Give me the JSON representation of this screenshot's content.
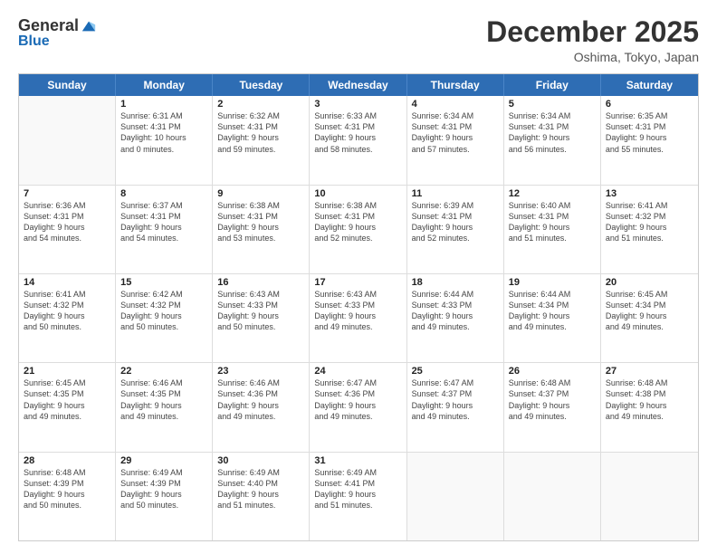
{
  "logo": {
    "general": "General",
    "blue": "Blue"
  },
  "title": "December 2025",
  "location": "Oshima, Tokyo, Japan",
  "header_days": [
    "Sunday",
    "Monday",
    "Tuesday",
    "Wednesday",
    "Thursday",
    "Friday",
    "Saturday"
  ],
  "weeks": [
    [
      {
        "day": "",
        "lines": [],
        "empty": true
      },
      {
        "day": "1",
        "lines": [
          "Sunrise: 6:31 AM",
          "Sunset: 4:31 PM",
          "Daylight: 10 hours",
          "and 0 minutes."
        ]
      },
      {
        "day": "2",
        "lines": [
          "Sunrise: 6:32 AM",
          "Sunset: 4:31 PM",
          "Daylight: 9 hours",
          "and 59 minutes."
        ]
      },
      {
        "day": "3",
        "lines": [
          "Sunrise: 6:33 AM",
          "Sunset: 4:31 PM",
          "Daylight: 9 hours",
          "and 58 minutes."
        ]
      },
      {
        "day": "4",
        "lines": [
          "Sunrise: 6:34 AM",
          "Sunset: 4:31 PM",
          "Daylight: 9 hours",
          "and 57 minutes."
        ]
      },
      {
        "day": "5",
        "lines": [
          "Sunrise: 6:34 AM",
          "Sunset: 4:31 PM",
          "Daylight: 9 hours",
          "and 56 minutes."
        ]
      },
      {
        "day": "6",
        "lines": [
          "Sunrise: 6:35 AM",
          "Sunset: 4:31 PM",
          "Daylight: 9 hours",
          "and 55 minutes."
        ]
      }
    ],
    [
      {
        "day": "7",
        "lines": [
          "Sunrise: 6:36 AM",
          "Sunset: 4:31 PM",
          "Daylight: 9 hours",
          "and 54 minutes."
        ]
      },
      {
        "day": "8",
        "lines": [
          "Sunrise: 6:37 AM",
          "Sunset: 4:31 PM",
          "Daylight: 9 hours",
          "and 54 minutes."
        ]
      },
      {
        "day": "9",
        "lines": [
          "Sunrise: 6:38 AM",
          "Sunset: 4:31 PM",
          "Daylight: 9 hours",
          "and 53 minutes."
        ]
      },
      {
        "day": "10",
        "lines": [
          "Sunrise: 6:38 AM",
          "Sunset: 4:31 PM",
          "Daylight: 9 hours",
          "and 52 minutes."
        ]
      },
      {
        "day": "11",
        "lines": [
          "Sunrise: 6:39 AM",
          "Sunset: 4:31 PM",
          "Daylight: 9 hours",
          "and 52 minutes."
        ]
      },
      {
        "day": "12",
        "lines": [
          "Sunrise: 6:40 AM",
          "Sunset: 4:31 PM",
          "Daylight: 9 hours",
          "and 51 minutes."
        ]
      },
      {
        "day": "13",
        "lines": [
          "Sunrise: 6:41 AM",
          "Sunset: 4:32 PM",
          "Daylight: 9 hours",
          "and 51 minutes."
        ]
      }
    ],
    [
      {
        "day": "14",
        "lines": [
          "Sunrise: 6:41 AM",
          "Sunset: 4:32 PM",
          "Daylight: 9 hours",
          "and 50 minutes."
        ]
      },
      {
        "day": "15",
        "lines": [
          "Sunrise: 6:42 AM",
          "Sunset: 4:32 PM",
          "Daylight: 9 hours",
          "and 50 minutes."
        ]
      },
      {
        "day": "16",
        "lines": [
          "Sunrise: 6:43 AM",
          "Sunset: 4:33 PM",
          "Daylight: 9 hours",
          "and 50 minutes."
        ]
      },
      {
        "day": "17",
        "lines": [
          "Sunrise: 6:43 AM",
          "Sunset: 4:33 PM",
          "Daylight: 9 hours",
          "and 49 minutes."
        ]
      },
      {
        "day": "18",
        "lines": [
          "Sunrise: 6:44 AM",
          "Sunset: 4:33 PM",
          "Daylight: 9 hours",
          "and 49 minutes."
        ]
      },
      {
        "day": "19",
        "lines": [
          "Sunrise: 6:44 AM",
          "Sunset: 4:34 PM",
          "Daylight: 9 hours",
          "and 49 minutes."
        ]
      },
      {
        "day": "20",
        "lines": [
          "Sunrise: 6:45 AM",
          "Sunset: 4:34 PM",
          "Daylight: 9 hours",
          "and 49 minutes."
        ]
      }
    ],
    [
      {
        "day": "21",
        "lines": [
          "Sunrise: 6:45 AM",
          "Sunset: 4:35 PM",
          "Daylight: 9 hours",
          "and 49 minutes."
        ]
      },
      {
        "day": "22",
        "lines": [
          "Sunrise: 6:46 AM",
          "Sunset: 4:35 PM",
          "Daylight: 9 hours",
          "and 49 minutes."
        ]
      },
      {
        "day": "23",
        "lines": [
          "Sunrise: 6:46 AM",
          "Sunset: 4:36 PM",
          "Daylight: 9 hours",
          "and 49 minutes."
        ]
      },
      {
        "day": "24",
        "lines": [
          "Sunrise: 6:47 AM",
          "Sunset: 4:36 PM",
          "Daylight: 9 hours",
          "and 49 minutes."
        ]
      },
      {
        "day": "25",
        "lines": [
          "Sunrise: 6:47 AM",
          "Sunset: 4:37 PM",
          "Daylight: 9 hours",
          "and 49 minutes."
        ]
      },
      {
        "day": "26",
        "lines": [
          "Sunrise: 6:48 AM",
          "Sunset: 4:37 PM",
          "Daylight: 9 hours",
          "and 49 minutes."
        ]
      },
      {
        "day": "27",
        "lines": [
          "Sunrise: 6:48 AM",
          "Sunset: 4:38 PM",
          "Daylight: 9 hours",
          "and 49 minutes."
        ]
      }
    ],
    [
      {
        "day": "28",
        "lines": [
          "Sunrise: 6:48 AM",
          "Sunset: 4:39 PM",
          "Daylight: 9 hours",
          "and 50 minutes."
        ]
      },
      {
        "day": "29",
        "lines": [
          "Sunrise: 6:49 AM",
          "Sunset: 4:39 PM",
          "Daylight: 9 hours",
          "and 50 minutes."
        ]
      },
      {
        "day": "30",
        "lines": [
          "Sunrise: 6:49 AM",
          "Sunset: 4:40 PM",
          "Daylight: 9 hours",
          "and 51 minutes."
        ]
      },
      {
        "day": "31",
        "lines": [
          "Sunrise: 6:49 AM",
          "Sunset: 4:41 PM",
          "Daylight: 9 hours",
          "and 51 minutes."
        ]
      },
      {
        "day": "",
        "lines": [],
        "empty": true
      },
      {
        "day": "",
        "lines": [],
        "empty": true
      },
      {
        "day": "",
        "lines": [],
        "empty": true
      }
    ]
  ]
}
